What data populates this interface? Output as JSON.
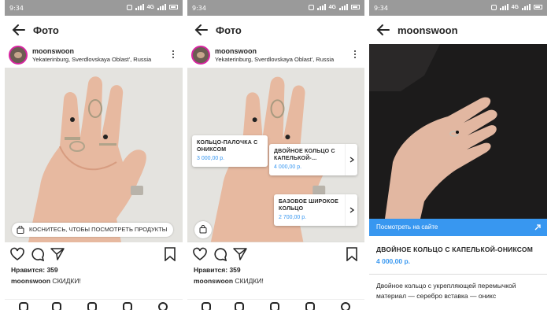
{
  "status_bar": {
    "time": "9:34",
    "network": "4G"
  },
  "screens": [
    {
      "title": "Фото",
      "username": "moonswoon",
      "location": "Yekaterinburg, Sverdlovskaya Oblast', Russia",
      "tap_hint": "КОСНИТЕСЬ, ЧТОБЫ ПОСМОТРЕТЬ ПРОДУКТЫ",
      "likes": "Нравится: 359",
      "caption_user": "moonswoon",
      "caption_text": " СКИДКИ!"
    },
    {
      "title": "Фото",
      "username": "moonswoon",
      "location": "Yekaterinburg, Sverdlovskaya Oblast', Russia",
      "tags": [
        {
          "name_line1": "КОЛЬЦО-ПАЛОЧКА С",
          "name_line2": "ОНИКСОМ",
          "price": "3 000,00 р."
        },
        {
          "name_line1": "ДВОЙНОЕ КОЛЬЦО С",
          "name_line2": "КАПЕЛЬКОЙ-...",
          "price": "4 000,00 р."
        },
        {
          "name_line1": "БАЗОВОЕ ШИРОКОЕ",
          "name_line2": "КОЛЬЦО",
          "price": "2 700,00 р."
        }
      ],
      "likes": "Нравится: 359",
      "caption_user": "moonswoon",
      "caption_text": " СКИДКИ!"
    },
    {
      "title": "moonswoon",
      "cta": "Посмотреть на сайте",
      "product_title": "ДВОЙНОЕ КОЛЬЦО С КАПЕЛЬКОЙ-ОНИКСОМ",
      "product_price": "4 000,00 р.",
      "description_line1": "Двойное кольцо с укрепляющей перемычкой",
      "description_line2": "материал — серебро вставка — оникс"
    }
  ],
  "icons": [
    "back-arrow-icon",
    "more-icon",
    "heart-icon",
    "comment-icon",
    "share-icon",
    "bookmark-icon",
    "shopping-bag-icon",
    "chevron-right-icon"
  ],
  "colors": {
    "accent": "#3897f0",
    "status_bar": "#9a9a9a",
    "text": "#262626"
  }
}
